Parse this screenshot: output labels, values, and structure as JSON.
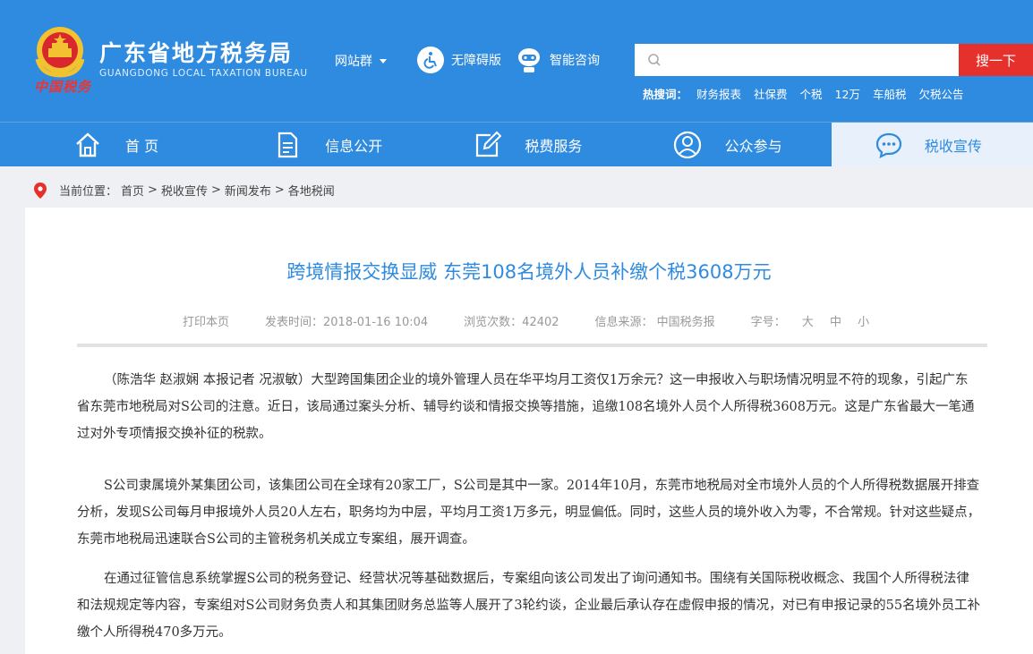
{
  "header": {
    "site_name": "广东省地方税务局",
    "site_subtitle": "GUANGDONG LOCAL TAXATION BUREAU",
    "emblem_text": "中国税务",
    "site_group_label": "网站群",
    "accessibility_label": "无障碍版",
    "consult_label": "智能咨询",
    "search": {
      "placeholder": "",
      "button_label": "搜一下"
    },
    "hot_label": "热搜词：",
    "hot_words": [
      "财务报表",
      "社保费",
      "个税",
      "12万",
      "车船税",
      "欠税公告"
    ]
  },
  "nav": {
    "items": [
      {
        "label": "首 页",
        "icon": "home-icon"
      },
      {
        "label": "信息公开",
        "icon": "document-icon"
      },
      {
        "label": "税费服务",
        "icon": "edit-icon"
      },
      {
        "label": "公众参与",
        "icon": "user-icon"
      },
      {
        "label": "税收宣传",
        "icon": "chat-icon",
        "active": true
      }
    ]
  },
  "breadcrumb": {
    "label": "当前位置：",
    "items": [
      "首页",
      "税收宣传",
      "新闻发布",
      "各地税闻"
    ],
    "separator": ">"
  },
  "article": {
    "title": "跨境情报交换显威 东莞108名境外人员补缴个税3608万元",
    "print_label": "打印本页",
    "publish_time": "发表时间：2018-01-16 10:04",
    "views": "浏览次数：42402",
    "source": "信息来源：  中国税务报",
    "font_size_label": "字号：",
    "font_sizes": [
      "大",
      "中",
      "小"
    ],
    "paragraphs": [
      "（陈浩华 赵淑娴 本报记者 况淑敏）大型跨国集团企业的境外管理人员在华平均月工资仅1万余元？这一申报收入与职场情况明显不符的现象，引起广东省东莞市地税局对S公司的注意。近日，该局通过案头分析、辅导约谈和情报交换等措施，追缴108名境外人员个人所得税3608万元。这是广东省最大一笔通过对外专项情报交换补征的税款。",
      "S公司隶属境外某集团公司，该集团公司在全球有20家工厂，S公司是其中一家。2014年10月，东莞市地税局对全市境外人员的个人所得税数据展开排查分析，发现S公司每月申报境外人员20人左右，职务均为中层，平均月工资1万多元，明显偏低。同时，这些人员的境外收入为零，不合常规。针对这些疑点，东莞市地税局迅速联合S公司的主管税务机关成立专案组，展开调查。",
      "在通过征管信息系统掌握S公司的税务登记、经营状况等基础数据后，专案组向该公司发出了询问通知书。围绕有关国际税收概念、我国个人所得税法律和法规规定等内容，专案组对S公司财务负责人和其集团财务总监等人展开了3轮约谈，企业最后承认存在虚假申报的情况，对已有申报记录的55名境外员工补缴个人所得税470多万元。"
    ]
  },
  "colors": {
    "brand_blue": "#2f8be0",
    "search_red": "#e5302c"
  }
}
